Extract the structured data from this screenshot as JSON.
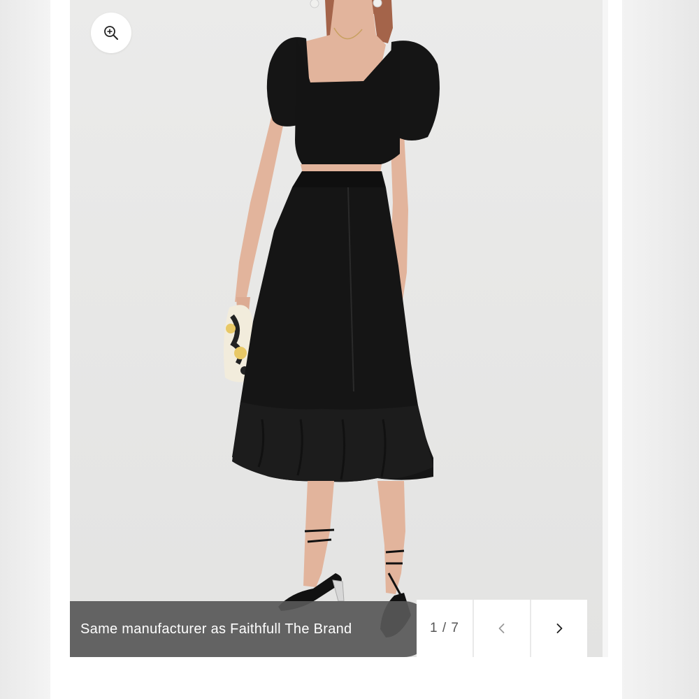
{
  "gallery": {
    "caption": "Same manufacturer as Faithfull The Brand",
    "page_counter": "1 / 7",
    "image_description_name": "product-photo",
    "icons": {
      "zoom": "zoom-in-icon",
      "prev": "chevron-left-icon",
      "next": "chevron-right-icon"
    }
  },
  "colors": {
    "background": "#f5f5f5",
    "card": "#ffffff",
    "photo_background": "#ebebea",
    "caption_pill": "#585858",
    "garment": "#151515",
    "skin": "#e2b49c",
    "hair": "#a4644a"
  }
}
